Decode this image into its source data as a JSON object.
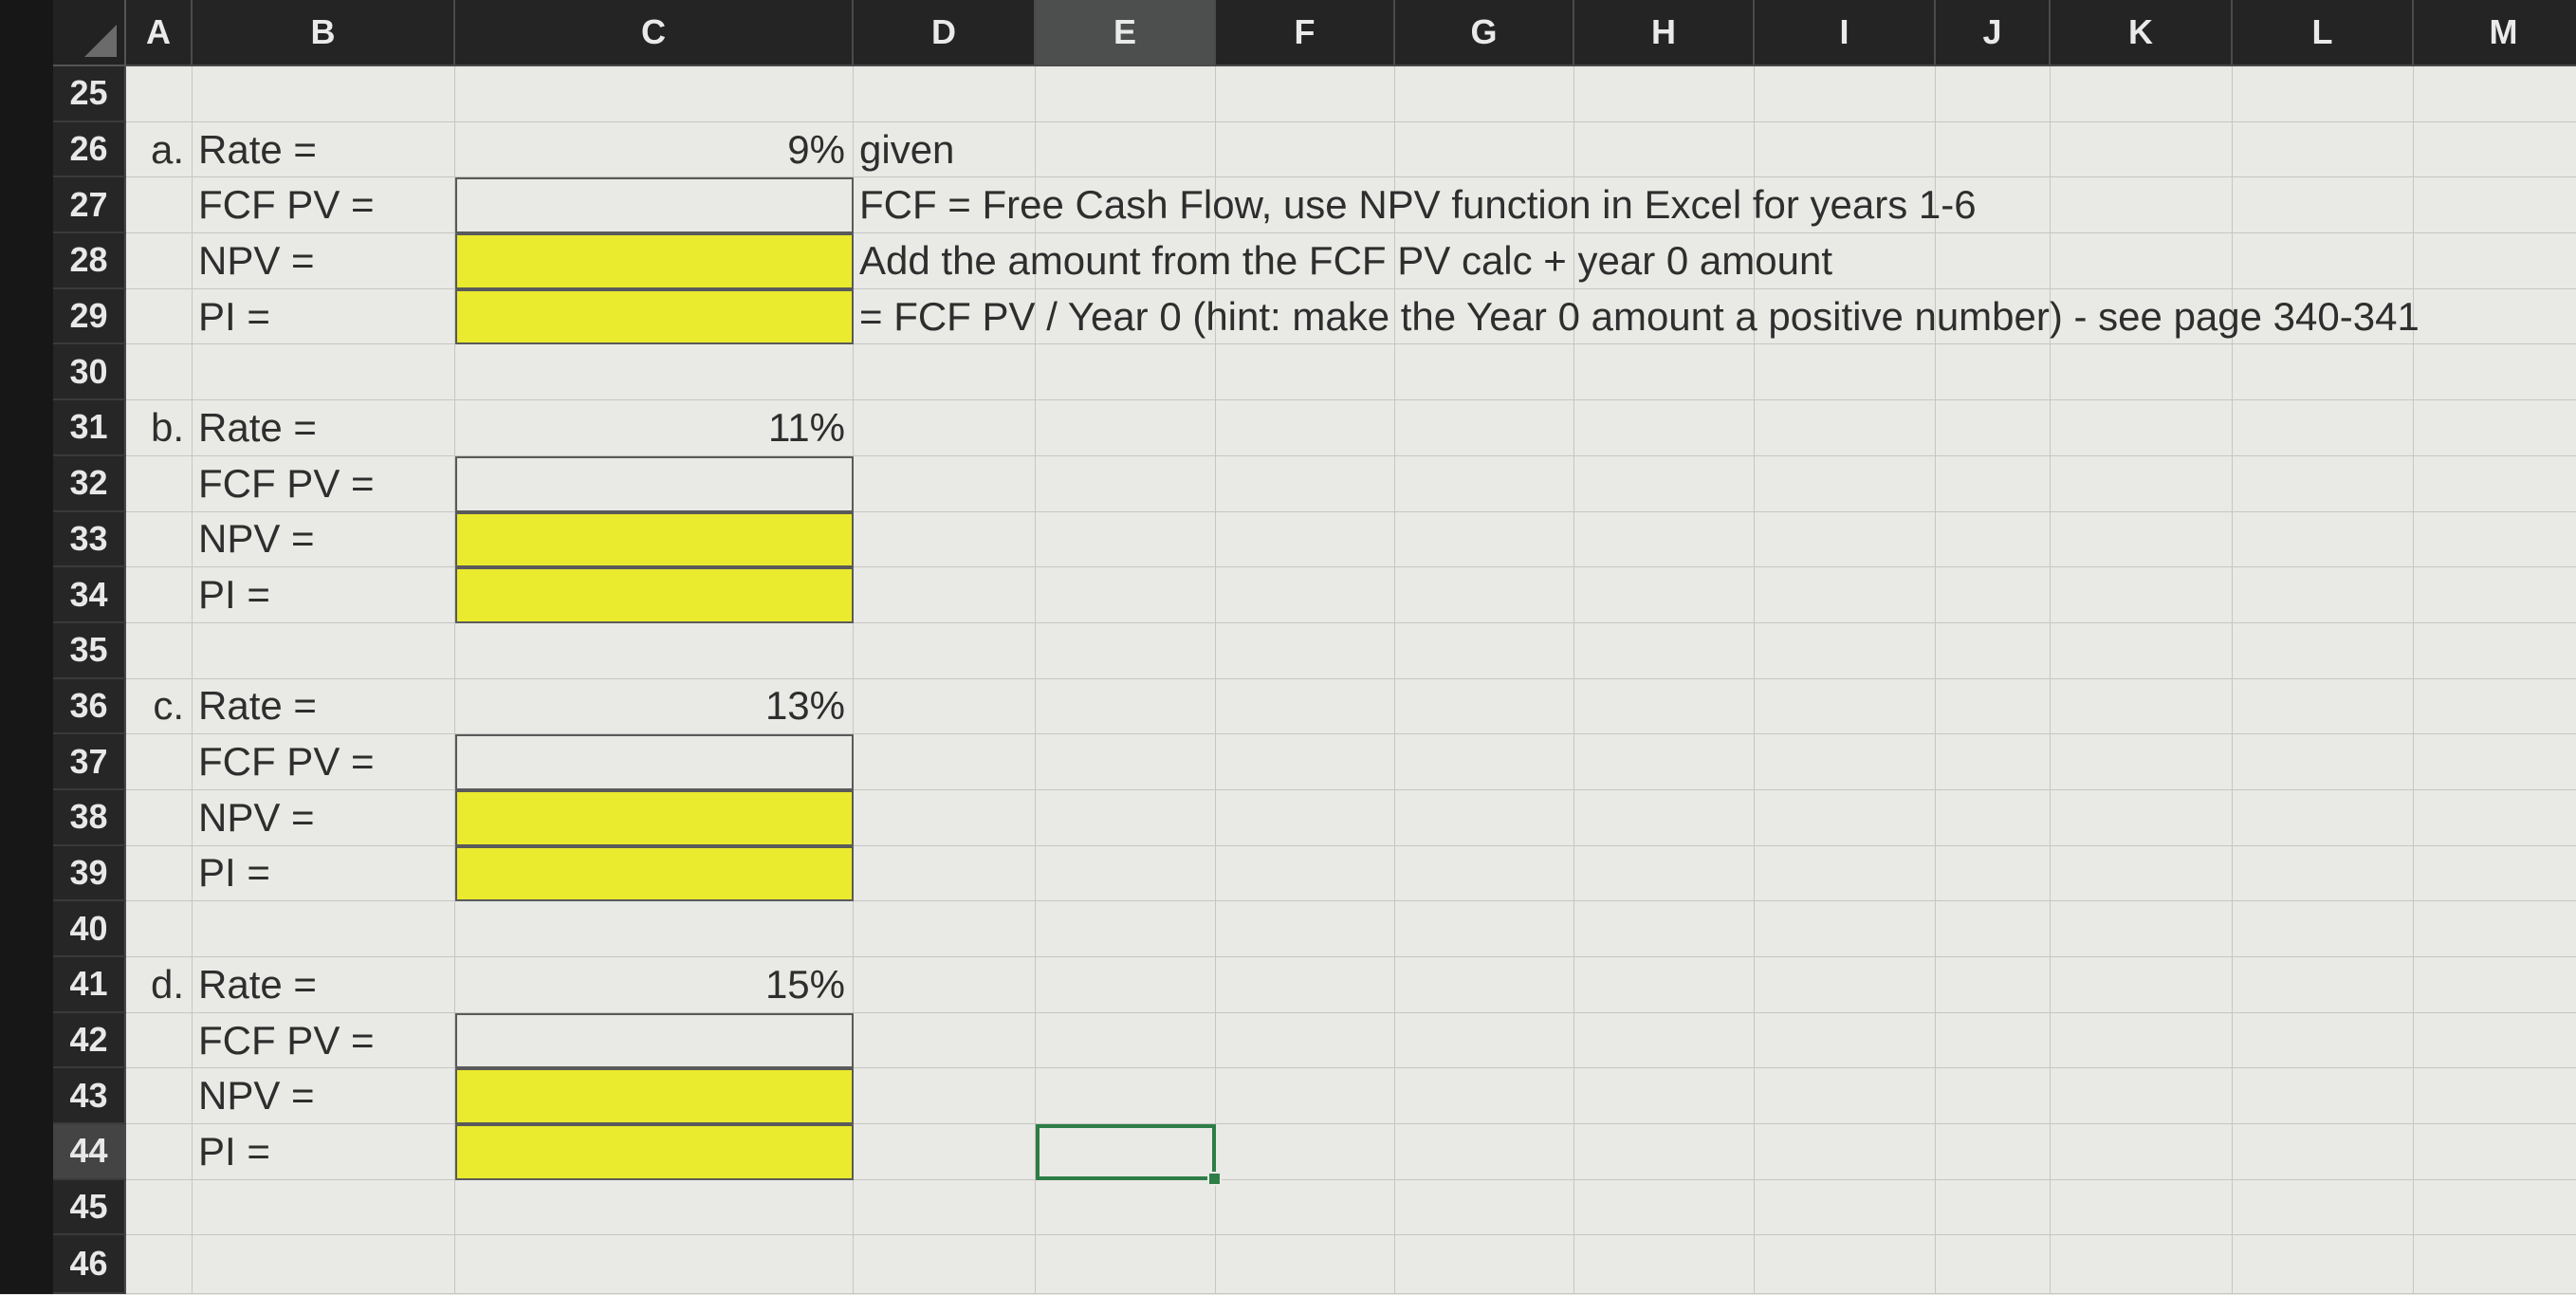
{
  "columns": [
    "A",
    "B",
    "C",
    "D",
    "E",
    "F",
    "G",
    "H",
    "I",
    "J",
    "K",
    "L",
    "M"
  ],
  "selected_column": "E",
  "active_cell": "E44",
  "rows": [
    "25",
    "26",
    "27",
    "28",
    "29",
    "30",
    "31",
    "32",
    "33",
    "34",
    "35",
    "36",
    "37",
    "38",
    "39",
    "40",
    "41",
    "42",
    "43",
    "44",
    "45",
    "46"
  ],
  "cells": {
    "r26": {
      "a": "a.",
      "b": "Rate =",
      "c": "9%",
      "d": "given"
    },
    "r27": {
      "b": "FCF PV =",
      "d": "FCF = Free Cash Flow, use NPV function in Excel for years 1-6"
    },
    "r28": {
      "b": "NPV =",
      "d": "Add the amount from the FCF PV calc + year 0 amount"
    },
    "r29": {
      "b": "PI =",
      "d": " = FCF PV / Year 0  (hint:  make the Year 0 amount a positive number) - see page 340-341"
    },
    "r31": {
      "a": "b.",
      "b": "Rate =",
      "c": "11%"
    },
    "r32": {
      "b": "FCF PV ="
    },
    "r33": {
      "b": "NPV ="
    },
    "r34": {
      "b": "PI ="
    },
    "r36": {
      "a": "c.",
      "b": "Rate =",
      "c": "13%"
    },
    "r37": {
      "b": "FCF PV ="
    },
    "r38": {
      "b": "NPV ="
    },
    "r39": {
      "b": "PI ="
    },
    "r41": {
      "a": "d.",
      "b": "Rate =",
      "c": "15%"
    },
    "r42": {
      "b": "FCF PV ="
    },
    "r43": {
      "b": "NPV ="
    },
    "r44": {
      "b": "PI ="
    }
  },
  "colors": {
    "highlight_fill": "#eaea2e",
    "selection_border": "#2e7d46",
    "header_bg": "#242424",
    "cell_bg": "#e9e9e6"
  }
}
